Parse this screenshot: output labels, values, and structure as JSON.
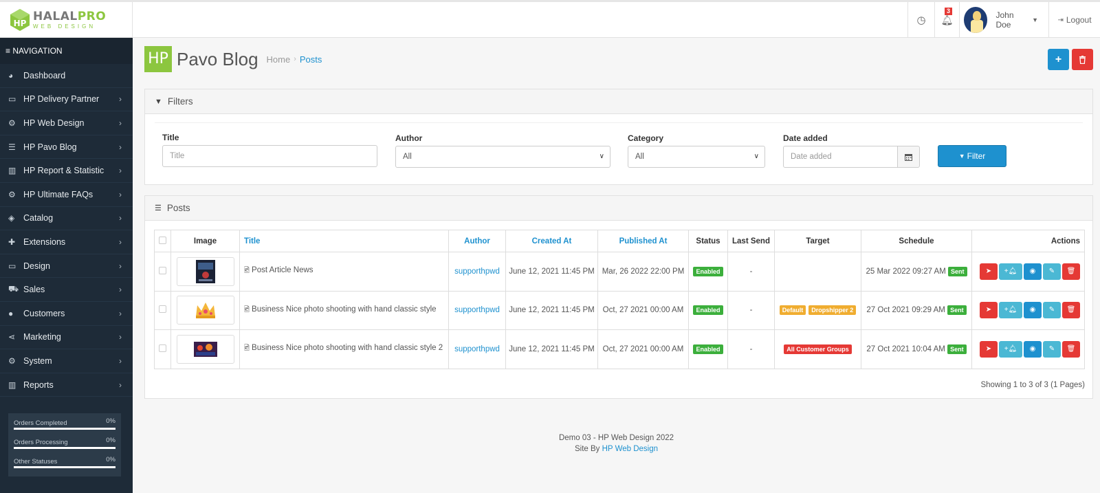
{
  "header": {
    "logo": {
      "brand_a": "HALAL",
      "brand_b": "PRO",
      "tagline": "WEB DESIGN"
    },
    "notifications_count": "3",
    "user_name": "John Doe",
    "logout_label": "Logout"
  },
  "sidebar": {
    "title": "NAVIGATION",
    "items": [
      {
        "label": "Dashboard",
        "icon": "dashboard-icon",
        "glyph": "◕",
        "arrow": ""
      },
      {
        "label": "HP Delivery Partner",
        "icon": "credit-card-icon",
        "glyph": "▭",
        "arrow": "›"
      },
      {
        "label": "HP Web Design",
        "icon": "cogs-icon",
        "glyph": "⚙",
        "arrow": "›"
      },
      {
        "label": "HP Pavo Blog",
        "icon": "list-alt-icon",
        "glyph": "☰",
        "arrow": "›"
      },
      {
        "label": "HP Report & Statistic",
        "icon": "bar-chart-icon",
        "glyph": "▥",
        "arrow": "›"
      },
      {
        "label": "HP Ultimate FAQs",
        "icon": "cogs-icon",
        "glyph": "⚙",
        "arrow": "›"
      },
      {
        "label": "Catalog",
        "icon": "tags-icon",
        "glyph": "◈",
        "arrow": "›"
      },
      {
        "label": "Extensions",
        "icon": "puzzle-icon",
        "glyph": "✚",
        "arrow": "›"
      },
      {
        "label": "Design",
        "icon": "desktop-icon",
        "glyph": "▭",
        "arrow": "›"
      },
      {
        "label": "Sales",
        "icon": "shopping-cart-icon",
        "glyph": "⛟",
        "arrow": "›"
      },
      {
        "label": "Customers",
        "icon": "user-icon",
        "glyph": "●",
        "arrow": "›"
      },
      {
        "label": "Marketing",
        "icon": "share-icon",
        "glyph": "⋖",
        "arrow": "›"
      },
      {
        "label": "System",
        "icon": "cog-icon",
        "glyph": "⚙",
        "arrow": "›"
      },
      {
        "label": "Reports",
        "icon": "bar-chart-icon",
        "glyph": "▥",
        "arrow": "›"
      }
    ],
    "stats": [
      {
        "label": "Orders Completed",
        "value": "0%"
      },
      {
        "label": "Orders Processing",
        "value": "0%"
      },
      {
        "label": "Other Statuses",
        "value": "0%"
      }
    ]
  },
  "page": {
    "logo_text": "HP",
    "title": "Pavo Blog",
    "breadcrumb": [
      "Home",
      "Posts"
    ]
  },
  "filters": {
    "heading": "Filters",
    "title_label": "Title",
    "title_placeholder": "Title",
    "author_label": "Author",
    "author_value": "All",
    "category_label": "Category",
    "category_value": "All",
    "date_label": "Date added",
    "date_placeholder": "Date added",
    "button_label": "Filter"
  },
  "posts": {
    "heading": "Posts",
    "columns": [
      "Image",
      "Title",
      "Author",
      "Created At",
      "Published At",
      "Status",
      "Last Send",
      "Target",
      "Schedule",
      "Actions"
    ],
    "rows": [
      {
        "title": "Post Article News",
        "author": "supporthpwd",
        "created": "June 12, 2021 11:45 PM",
        "published": "Mar, 26 2022 22:00 PM",
        "status": "Enabled",
        "last_send": "-",
        "targets": [],
        "schedule": "25 Mar 2022 09:27 AM",
        "schedule_badge": "Sent"
      },
      {
        "title": "Business Nice photo shooting with hand classic style",
        "author": "supporthpwd",
        "created": "June 12, 2021 11:45 PM",
        "published": "Oct, 27 2021 00:00 AM",
        "status": "Enabled",
        "last_send": "-",
        "targets": [
          {
            "text": "Default",
            "color": "#f0ad30"
          },
          {
            "text": "Dropshipper 2",
            "color": "#f0ad30"
          }
        ],
        "schedule": "27 Oct 2021 09:29 AM",
        "schedule_badge": "Sent"
      },
      {
        "title": "Business Nice photo shooting with hand classic style 2",
        "author": "supporthpwd",
        "created": "June 12, 2021 11:45 PM",
        "published": "Oct, 27 2021 00:00 AM",
        "status": "Enabled",
        "last_send": "-",
        "targets": [
          {
            "text": "All Customer Groups",
            "color": "#e53935"
          }
        ],
        "schedule": "27 Oct 2021 10:04 AM",
        "schedule_badge": "Sent"
      }
    ],
    "showing": "Showing 1 to 3 of 3 (1 Pages)"
  },
  "footer": {
    "line1": "Demo 03 - HP Web Design 2022",
    "line2_prefix": "Site By ",
    "line2_link": "HP Web Design"
  },
  "colors": {
    "accent": "#1e91cf",
    "danger": "#e53935",
    "success": "#3caf3c",
    "warning": "#f0ad30",
    "brand_green": "#8cc63f",
    "sidebar": "#1e2b38"
  }
}
